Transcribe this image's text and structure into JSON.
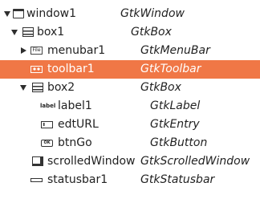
{
  "tree": {
    "rows": [
      {
        "name": "window1",
        "type": "GtkWindow",
        "icon": "window-icon",
        "expander": "expanded",
        "selected": false
      },
      {
        "name": "box1",
        "type": "GtkBox",
        "icon": "box-icon",
        "expander": "expanded",
        "selected": false
      },
      {
        "name": "menubar1",
        "type": "GtkMenuBar",
        "icon": "menubar-icon",
        "icon_text": "File",
        "expander": "collapsed",
        "selected": false
      },
      {
        "name": "toolbar1",
        "type": "GtkToolbar",
        "icon": "toolbar-icon",
        "expander": "none",
        "selected": true
      },
      {
        "name": "box2",
        "type": "GtkBox",
        "icon": "box-icon",
        "expander": "expanded",
        "selected": false
      },
      {
        "name": "label1",
        "type": "GtkLabel",
        "icon": "label-icon",
        "icon_text": "label",
        "expander": "none",
        "selected": false
      },
      {
        "name": "edtURL",
        "type": "GtkEntry",
        "icon": "entry-icon",
        "expander": "none",
        "selected": false
      },
      {
        "name": "btnGo",
        "type": "GtkButton",
        "icon": "button-icon",
        "icon_text": "OK",
        "expander": "none",
        "selected": false
      },
      {
        "name": "scrolledWindow",
        "type": "GtkScrolledWindow",
        "icon": "scrolled-window-icon",
        "expander": "none",
        "selected": false
      },
      {
        "name": "statusbar1",
        "type": "GtkStatusbar",
        "icon": "statusbar-icon",
        "expander": "none",
        "selected": false
      }
    ]
  },
  "colors": {
    "selection": "#f07746",
    "text": "#222222",
    "background": "#ffffff"
  }
}
